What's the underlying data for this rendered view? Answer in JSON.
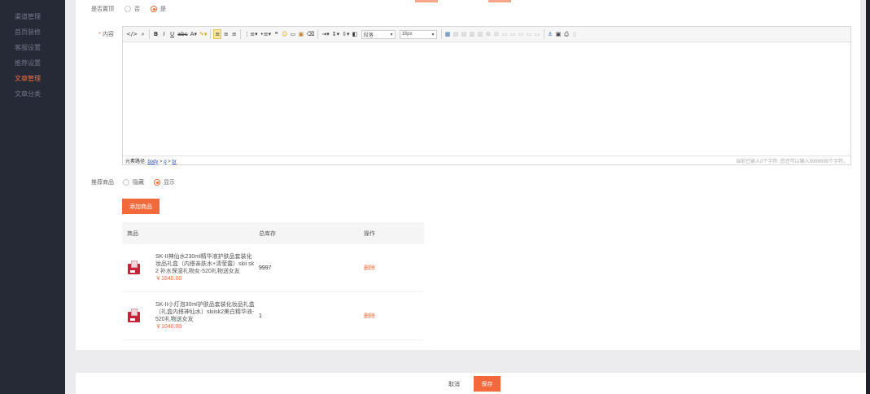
{
  "sidebar": {
    "items": [
      {
        "label": "渠道管理",
        "active": false
      },
      {
        "label": "首页装修",
        "active": false
      },
      {
        "label": "客服设置",
        "active": false
      },
      {
        "label": "推荐设置",
        "active": false
      },
      {
        "label": "文章管理",
        "active": true
      },
      {
        "label": "文章分类",
        "active": false
      }
    ]
  },
  "form": {
    "top_row": {
      "label": "是否置顶",
      "options": [
        "否",
        "是"
      ],
      "selected": "是"
    },
    "content": {
      "required_mark": "*",
      "label": "内容"
    },
    "recommend": {
      "label": "推荐商品",
      "options": [
        "隐藏",
        "显示"
      ],
      "selected": "显示"
    }
  },
  "editor": {
    "toolbar": {
      "paragraph_select": "段落",
      "fontsize_select": "16px",
      "icons": [
        "source-icon",
        "find-icon",
        "bold-icon",
        "italic-icon",
        "underline-icon",
        "strikethrough-icon",
        "font-color-icon",
        "highlight-icon",
        "align-left-icon",
        "align-center-icon",
        "align-right-icon",
        "ordered-list-icon",
        "unordered-list-icon",
        "blockquote-icon",
        "emoji-icon",
        "hr-icon",
        "image-icon",
        "clear-format-icon",
        "indent-icon",
        "line-height-icon",
        "paragraph-spacing-icon",
        "rtl-icon",
        "table-icon",
        "anchor-icon",
        "print-icon",
        "preview-icon"
      ]
    },
    "statusbar": {
      "path_label": "元素路径:",
      "path": [
        "body",
        "p",
        "br"
      ],
      "count_text": "当前已输入0个字符, 您还可以输入9999999个字符。"
    }
  },
  "add_product_button": "添加商品",
  "product_table": {
    "headers": [
      "商品",
      "总库存",
      "操作"
    ],
    "rows": [
      {
        "title": "SK-II神仙水230ml精华液护肤品套装化妆品礼盒（内搭亲肤水+清莹露）skii sk2 补水保湿礼物女-520礼物送女友",
        "price": "￥1640.00",
        "stock": "9997",
        "action": "删除"
      },
      {
        "title": "SK-II小灯泡30ml护肤品套装化妆品礼盒（礼盒内搭神仙水）skiisk2美白精华液-520礼物送女友",
        "price": "￥1040.00",
        "stock": "1",
        "action": "删除"
      }
    ]
  },
  "footer": {
    "cancel": "取消",
    "save": "保存"
  },
  "colors": {
    "accent": "#f4693b",
    "sidebar_bg": "#262a36",
    "page_bg": "#ececee"
  }
}
